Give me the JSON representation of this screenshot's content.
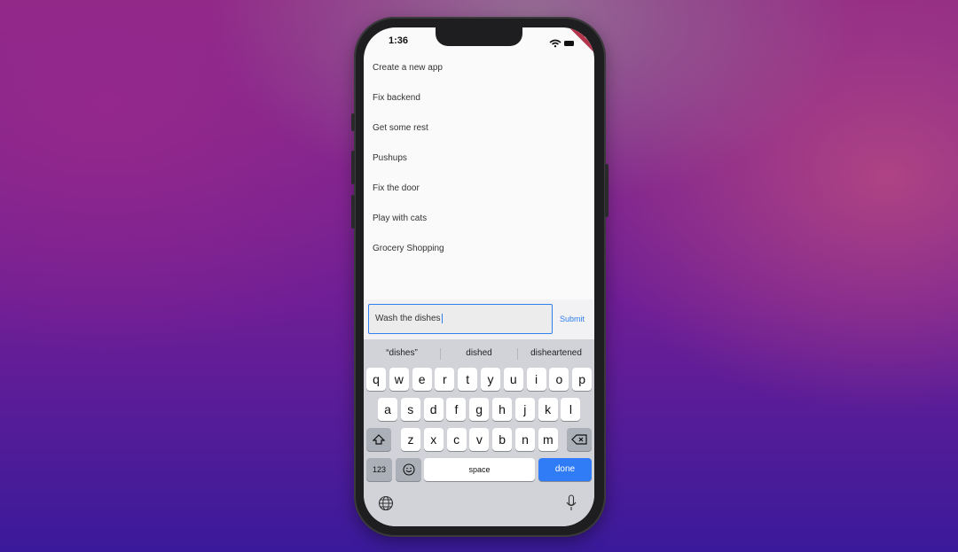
{
  "status_bar": {
    "time": "1:36",
    "icons": [
      "wifi-icon",
      "battery-icon"
    ],
    "debug_banner": "DEBUG"
  },
  "todo_list": {
    "items": [
      "Create a new app",
      "Fix backend",
      "Get some rest",
      "Pushups",
      "Fix the door",
      "Play with cats",
      "Grocery Shopping"
    ]
  },
  "input_bar": {
    "value": "Wash the dishes",
    "submit_label": "Submit"
  },
  "keyboard": {
    "suggestions": [
      "“dishes”",
      "dished",
      "disheartened"
    ],
    "row1": [
      "q",
      "w",
      "e",
      "r",
      "t",
      "y",
      "u",
      "i",
      "o",
      "p"
    ],
    "row2": [
      "a",
      "s",
      "d",
      "f",
      "g",
      "h",
      "j",
      "k",
      "l"
    ],
    "row3": [
      "z",
      "x",
      "c",
      "v",
      "b",
      "n",
      "m"
    ],
    "numbers_label": "123",
    "space_label": "space",
    "done_label": "done"
  },
  "colors": {
    "accent": "#2f80ed",
    "done_key": "#2f7cf6",
    "debug_banner": "#b3364d"
  }
}
